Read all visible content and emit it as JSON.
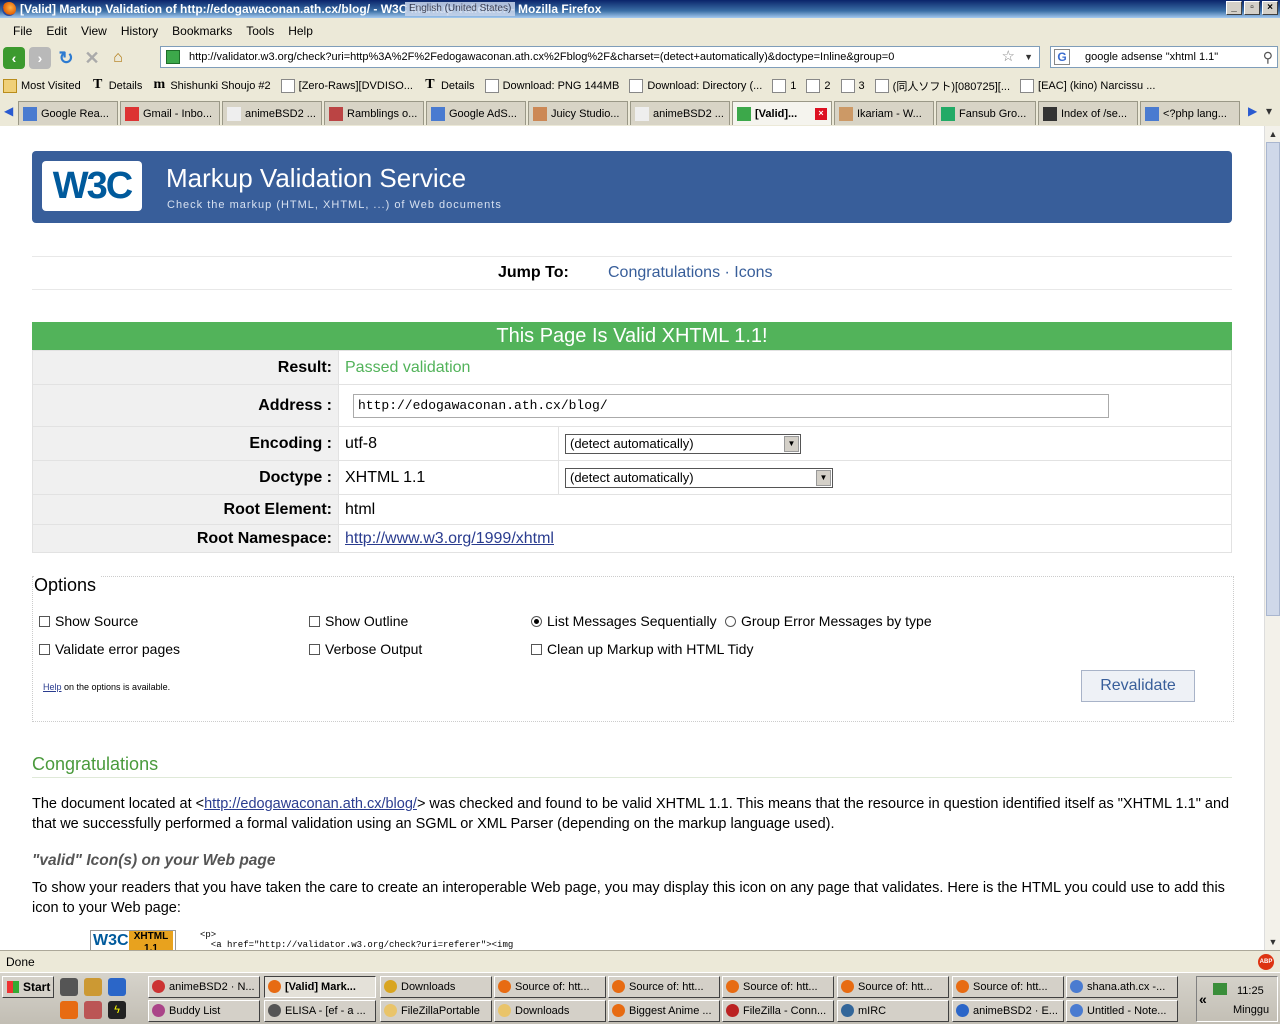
{
  "window": {
    "title": "[Valid] Markup Validation of http://edogawaconan.ath.cx/blog/ - W3C Markup Validator - Mozilla Firefox",
    "lang_overlay": "English (United States)"
  },
  "menu": [
    "File",
    "Edit",
    "View",
    "History",
    "Bookmarks",
    "Tools",
    "Help"
  ],
  "nav": {
    "url": "http://validator.w3.org/check?uri=http%3A%2F%2Fedogawaconan.ath.cx%2Fblog%2F&charset=(detect+automatically)&doctype=Inline&group=0",
    "search": "google adsense \"xhtml 1.1\""
  },
  "bookmarks": [
    {
      "label": "Most Visited",
      "icon": "folder-icon"
    },
    {
      "label": "Details",
      "icon": "t-icon"
    },
    {
      "label": "Shishunki Shoujo #2",
      "icon": "m-icon"
    },
    {
      "label": "[Zero-Raws][DVDISO...",
      "icon": "page-icon"
    },
    {
      "label": "Details",
      "icon": "t-icon"
    },
    {
      "label": "Download: PNG 144MB",
      "icon": "page-icon"
    },
    {
      "label": "Download: Directory (...",
      "icon": "page-icon"
    },
    {
      "label": "1",
      "icon": "page-icon"
    },
    {
      "label": "2",
      "icon": "page-icon"
    },
    {
      "label": "3",
      "icon": "page-icon"
    },
    {
      "label": "(同人ソフト)[080725][...",
      "icon": "page-icon"
    },
    {
      "label": "[EAC] (kino) Narcissu ...",
      "icon": "page-icon"
    }
  ],
  "tabs": [
    {
      "label": "Google Rea...",
      "color": "#4a7bd0",
      "active": false
    },
    {
      "label": "Gmail - Inbo...",
      "color": "#d33",
      "active": false
    },
    {
      "label": "animeBSD2 ...",
      "color": "#eee",
      "active": false
    },
    {
      "label": "Ramblings o...",
      "color": "#b44",
      "active": false
    },
    {
      "label": "Google AdS...",
      "color": "#4a7bd0",
      "active": false
    },
    {
      "label": "Juicy Studio...",
      "color": "#c85",
      "active": false
    },
    {
      "label": "animeBSD2 ...",
      "color": "#eee",
      "active": false
    },
    {
      "label": "[Valid]...",
      "color": "#3ca84a",
      "active": true
    },
    {
      "label": "Ikariam - W...",
      "color": "#c96",
      "active": false
    },
    {
      "label": "Fansub Gro...",
      "color": "#2a6",
      "active": false
    },
    {
      "label": "Index of /se...",
      "color": "#333",
      "active": false
    },
    {
      "label": "<?php lang...",
      "color": "#4a7bd0",
      "active": false
    }
  ],
  "page": {
    "banner_title": "Markup Validation Service",
    "banner_sub": "Check the markup (HTML, XHTML, ...) of Web documents",
    "logo": "W3C",
    "jump_label": "Jump To:",
    "jump_links": "Congratulations · Icons",
    "valid_msg": "This Page Is Valid XHTML 1.1!",
    "rows": {
      "result_label": "Result:",
      "result_val": "Passed validation",
      "address_label": "Address :",
      "address_val": "http://edogawaconan.ath.cx/blog/",
      "encoding_label": "Encoding :",
      "encoding_val": "utf-8",
      "encoding_sel": "(detect automatically)",
      "doctype_label": "Doctype :",
      "doctype_val": "XHTML 1.1",
      "doctype_sel": "(detect automatically)",
      "root_label": "Root Element:",
      "root_val": "html",
      "ns_label": "Root Namespace:",
      "ns_val": "http://www.w3.org/1999/xhtml"
    },
    "options": {
      "title": "Options",
      "show_source": "Show Source",
      "show_outline": "Show Outline",
      "list_seq": "List Messages Sequentially",
      "group_err": "Group Error Messages by type",
      "validate_err": "Validate error pages",
      "verbose": "Verbose Output",
      "tidy": "Clean up Markup with HTML Tidy",
      "help_link": "Help",
      "help_rest": " on the options is available.",
      "revalidate": "Revalidate"
    },
    "congrats_title": "Congratulations",
    "congrats_p1_a": "The document located at <",
    "congrats_p1_link": "http://edogawaconan.ath.cx/blog/",
    "congrats_p1_b": "> was checked and found to be valid XHTML 1.1. This means that the resource in question identified itself as \"XHTML 1.1\" and that we successfully performed a formal validation using an SGML or XML Parser (depending on the markup language used).",
    "icons_title": "\"valid\" Icon(s) on your Web page",
    "icons_p": "To show your readers that you have taken the care to create an interoperable Web page, you may display this icon on any page that validates. Here is the HTML you could use to add this icon to your Web page:",
    "badge_w": "W3C",
    "badge_x": "XHTML 1.1",
    "code": "<p>\n  <a href=\"http://validator.w3.org/check?uri=referer\"><img"
  },
  "status": {
    "text": "Done",
    "abp": "ABP"
  },
  "taskbar": {
    "start": "Start",
    "row1": [
      "animeBSD2 · N...",
      "[Valid] Mark...",
      "Downloads",
      "Source of: htt...",
      "Source of: htt...",
      "Source of: htt...",
      "Source of: htt...",
      "Source of: htt...",
      "shana.ath.cx -..."
    ],
    "row2": [
      "Buddy List",
      "ELISA - [ef - a ...",
      "FileZillaPortable",
      "Downloads",
      "Biggest Anime ...",
      "FileZilla - Conn...",
      "mIRC",
      "animeBSD2 · E...",
      "Untitled - Note..."
    ],
    "time": "11:25",
    "day": "Minggu"
  }
}
